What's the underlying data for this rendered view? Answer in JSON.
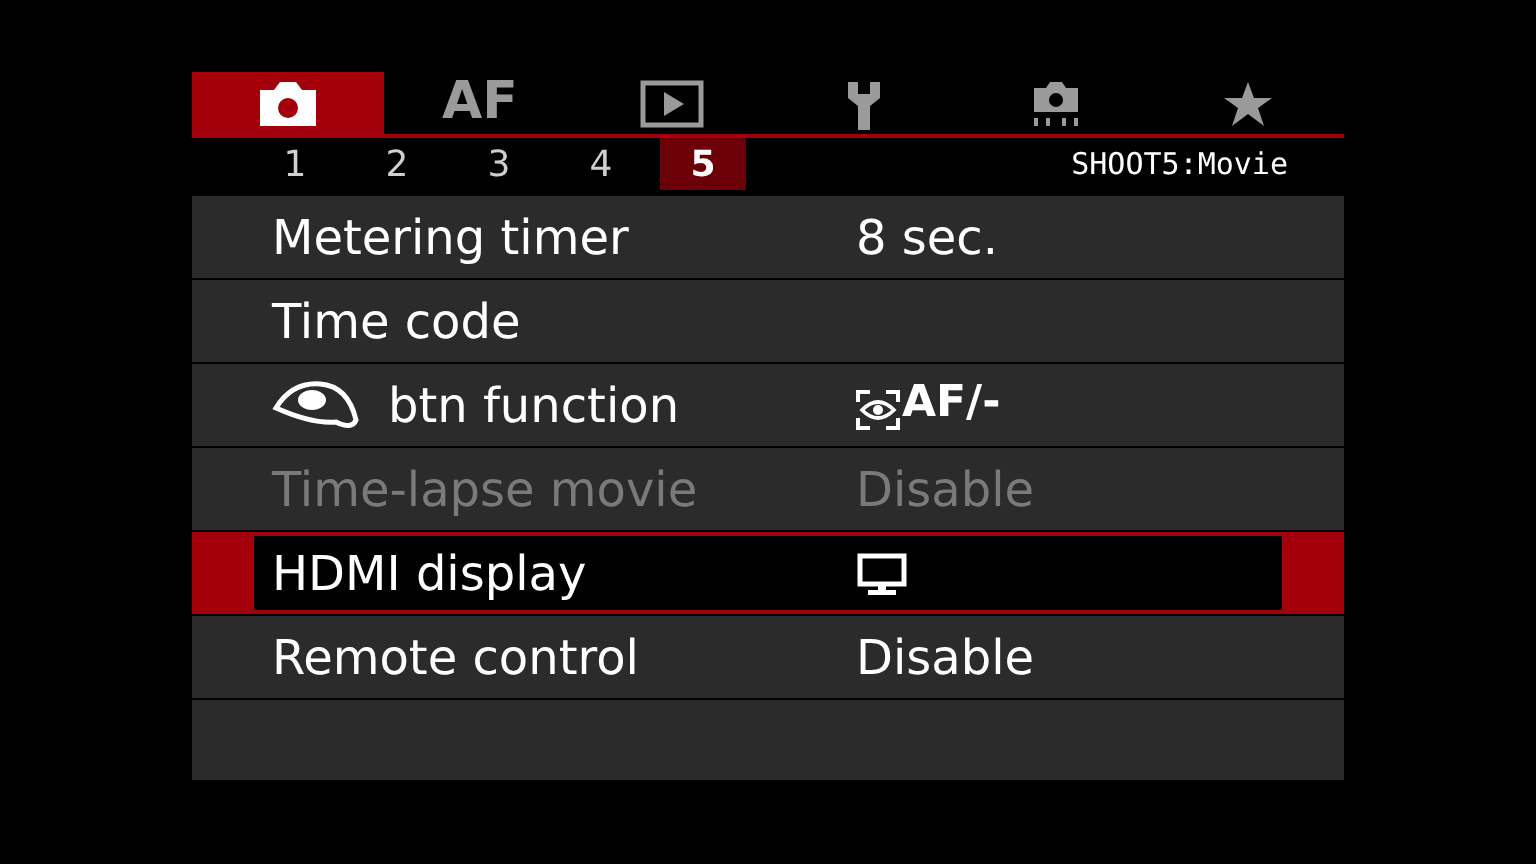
{
  "tabs": [
    {
      "kind": "camera",
      "selected": true
    },
    {
      "kind": "text",
      "label": "AF",
      "selected": false
    },
    {
      "kind": "play",
      "selected": false
    },
    {
      "kind": "wrench",
      "selected": false
    },
    {
      "kind": "camera-dots",
      "selected": false
    },
    {
      "kind": "star",
      "selected": false
    }
  ],
  "pages": [
    {
      "label": "1",
      "selected": false
    },
    {
      "label": "2",
      "selected": false
    },
    {
      "label": "3",
      "selected": false
    },
    {
      "label": "4",
      "selected": false
    },
    {
      "label": "5",
      "selected": true
    }
  ],
  "menu_title": "SHOOT5:Movie",
  "items": [
    {
      "label": "Metering timer",
      "value": {
        "kind": "text",
        "text": "8 sec."
      },
      "disabled": false,
      "selected": false
    },
    {
      "label": "Time code",
      "disabled": false,
      "selected": false
    },
    {
      "label": "btn function",
      "label_icon": {
        "kind": "eye"
      },
      "value": {
        "kind": "eye-af",
        "text": "AF/-"
      },
      "disabled": false,
      "selected": false
    },
    {
      "label": "Time-lapse movie",
      "value": {
        "kind": "text",
        "text": "Disable"
      },
      "disabled": true,
      "selected": false
    },
    {
      "label": "HDMI display",
      "value": {
        "kind": "monitor"
      },
      "disabled": false,
      "selected": true
    },
    {
      "label": "Remote control",
      "value": {
        "kind": "text",
        "text": "Disable"
      },
      "disabled": false,
      "selected": false
    }
  ]
}
